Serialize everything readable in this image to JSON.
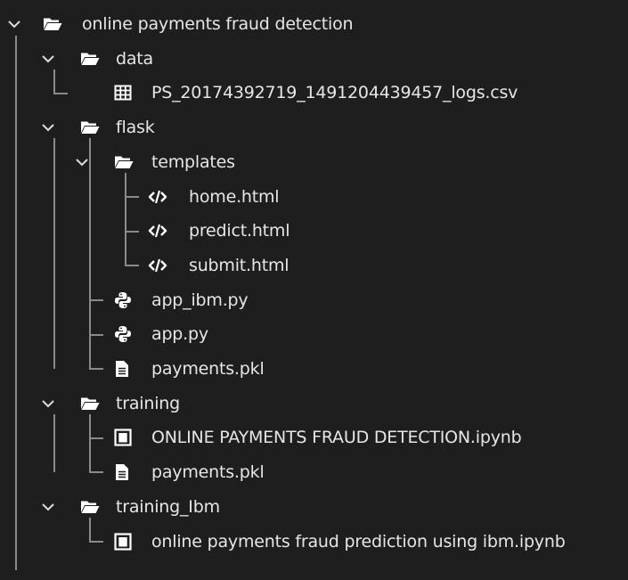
{
  "tree": [
    {
      "label": "online payments fraud detection",
      "icon": "folder-open-icon",
      "expanded": true,
      "depth": 0
    },
    {
      "label": "data",
      "icon": "folder-open-icon",
      "expanded": true,
      "depth": 1
    },
    {
      "label": "PS_20174392719_1491204439457_logs.csv",
      "icon": "table-grid-icon",
      "depth": 2
    },
    {
      "label": "flask",
      "icon": "folder-open-icon",
      "expanded": true,
      "depth": 1
    },
    {
      "label": "templates",
      "icon": "folder-open-icon",
      "expanded": true,
      "depth": 2
    },
    {
      "label": "home.html",
      "icon": "code-tag-icon",
      "depth": 3
    },
    {
      "label": "predict.html",
      "icon": "code-tag-icon",
      "depth": 3
    },
    {
      "label": "submit.html",
      "icon": "code-tag-icon",
      "depth": 3
    },
    {
      "label": "app_ibm.py",
      "icon": "python-icon",
      "depth": 2
    },
    {
      "label": "app.py",
      "icon": "python-icon",
      "depth": 2
    },
    {
      "label": "payments.pkl",
      "icon": "file-text-icon",
      "depth": 2
    },
    {
      "label": "training",
      "icon": "folder-open-icon",
      "expanded": true,
      "depth": 1
    },
    {
      "label": "ONLINE PAYMENTS FRAUD DETECTION.ipynb",
      "icon": "notebook-icon",
      "depth": 2
    },
    {
      "label": "payments.pkl",
      "icon": "file-text-icon",
      "depth": 2
    },
    {
      "label": "training_Ibm",
      "icon": "folder-open-icon",
      "expanded": true,
      "depth": 1
    },
    {
      "label": "online payments fraud prediction using ibm.ipynb",
      "icon": "notebook-icon",
      "depth": 2
    }
  ],
  "colors": {
    "background": "#1e1e1e",
    "text": "#e6e6e6",
    "icon": "#ffffff",
    "guide": "#8a8a8a"
  }
}
